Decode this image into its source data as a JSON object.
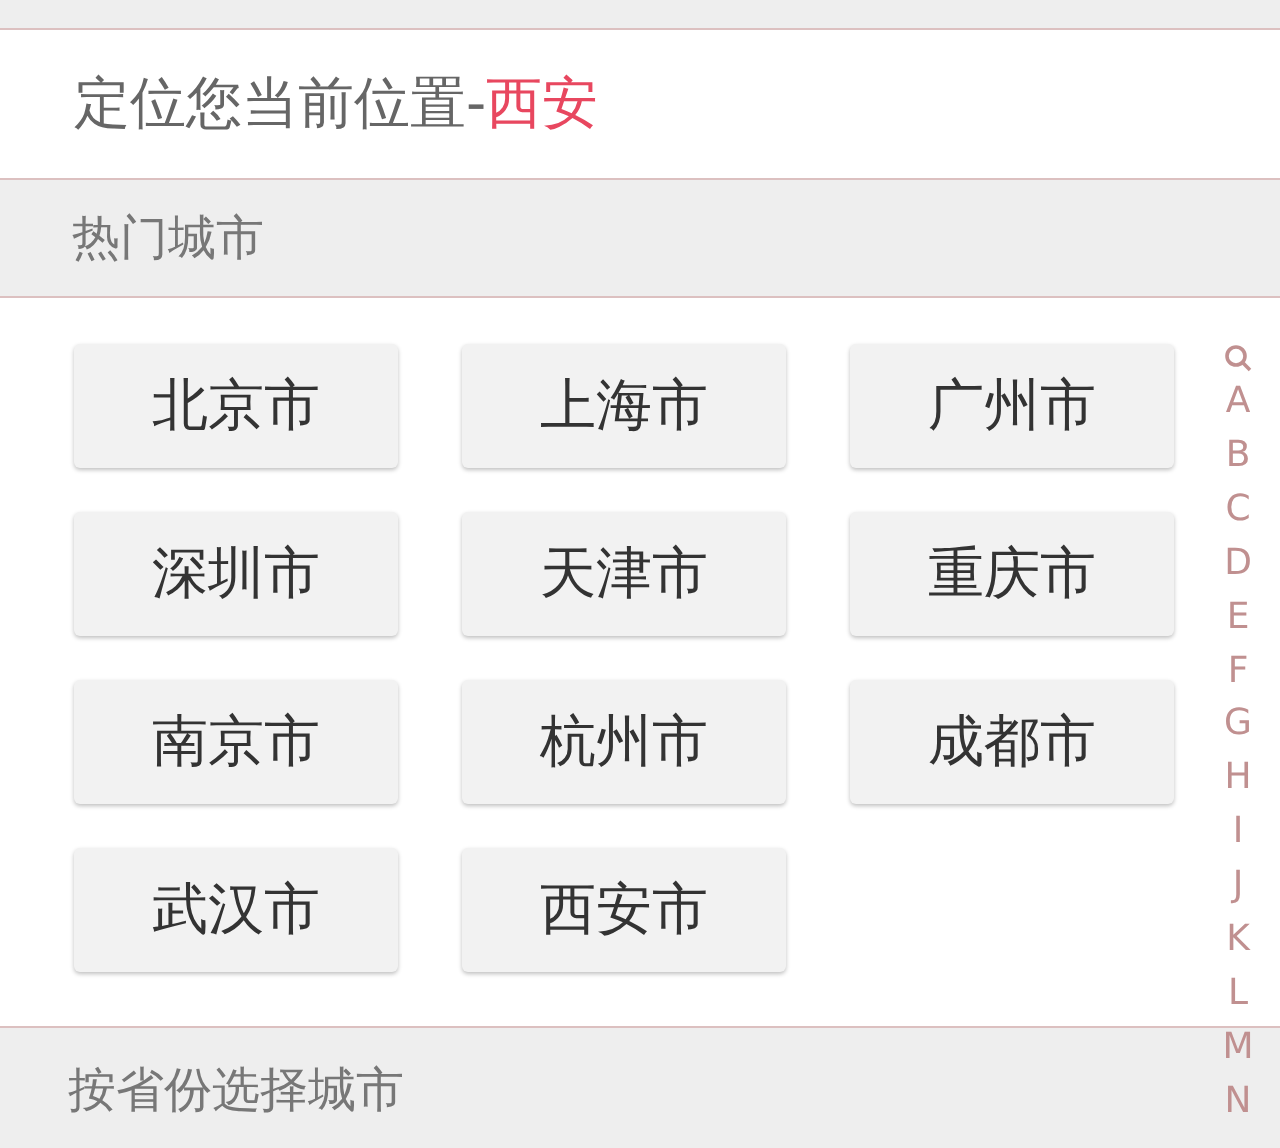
{
  "location": {
    "label": "定位您当前位置-",
    "city": "西安"
  },
  "hot_header": "热门城市",
  "hot_cities": [
    "北京市",
    "上海市",
    "广州市",
    "深圳市",
    "天津市",
    "重庆市",
    "南京市",
    "杭州市",
    "成都市",
    "武汉市",
    "西安市"
  ],
  "province_header": "按省份选择城市",
  "index": [
    "A",
    "B",
    "C",
    "D",
    "E",
    "F",
    "G",
    "H",
    "I",
    "J",
    "K",
    "L",
    "M",
    "N"
  ]
}
